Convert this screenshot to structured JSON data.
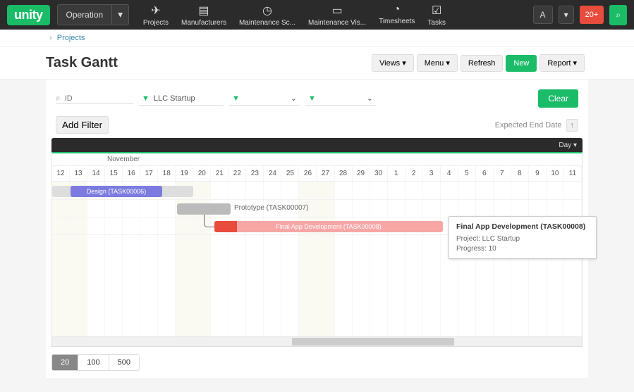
{
  "logo": "unity",
  "operation_label": "Operation",
  "nav": {
    "projects": "Projects",
    "manufacturers": "Manufacturers",
    "maintenance_sc": "Maintenance Sc...",
    "maintenance_vis": "Maintenance Vis...",
    "timesheets": "Timesheets",
    "tasks": "Tasks"
  },
  "avatar": "A",
  "notif": "20+",
  "breadcrumb": {
    "projects": "Projects"
  },
  "page_title": "Task Gantt",
  "header_buttons": {
    "views": "Views",
    "menu": "Menu",
    "refresh": "Refresh",
    "new": "New",
    "report": "Report"
  },
  "filters": {
    "id_placeholder": "ID",
    "project": "LLC Startup",
    "clear": "Clear",
    "add_filter": "Add Filter",
    "expected": "Expected End Date"
  },
  "scale": {
    "day": "Day"
  },
  "chart_data": {
    "type": "gantt",
    "month": "November",
    "days": [
      "12",
      "13",
      "14",
      "15",
      "16",
      "17",
      "18",
      "19",
      "20",
      "21",
      "22",
      "23",
      "24",
      "25",
      "26",
      "27",
      "28",
      "29",
      "30",
      "1",
      "2",
      "3",
      "4",
      "5",
      "6",
      "7",
      "8",
      "9",
      "10",
      "11"
    ],
    "tasks": [
      {
        "label": "Design (TASK00006)"
      },
      {
        "label": "Prototype (TASK00007)"
      },
      {
        "label": "Final App Development (TASK00008)"
      }
    ]
  },
  "tooltip": {
    "title": "Final App Development (TASK00008)",
    "project": "Project: LLC Startup",
    "progress": "Progress: 10"
  },
  "pager": {
    "p20": "20",
    "p100": "100",
    "p500": "500"
  }
}
